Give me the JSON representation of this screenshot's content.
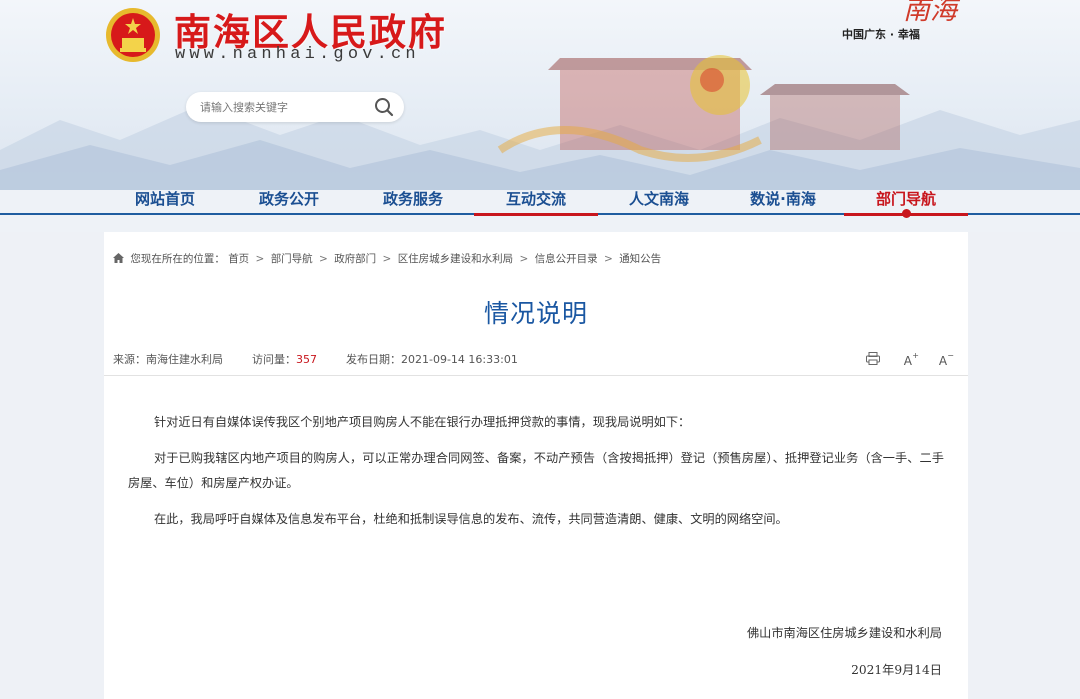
{
  "header": {
    "site_title": "南海区人民政府",
    "site_url": "www.nanhai.gov.cn",
    "region_text": "中国广东 · 幸福",
    "region_art": "南海",
    "search": {
      "placeholder": "请输入搜索关键字"
    }
  },
  "nav": {
    "items": [
      {
        "label": "网站首页"
      },
      {
        "label": "政务公开"
      },
      {
        "label": "政务服务"
      },
      {
        "label": "互动交流"
      },
      {
        "label": "人文南海"
      },
      {
        "label": "数说·南海"
      },
      {
        "label": "部门导航"
      }
    ]
  },
  "breadcrumb": {
    "prefix": "您现在所在的位置：",
    "items": [
      "首页",
      "部门导航",
      "政府部门",
      "区住房城乡建设和水利局",
      "信息公开目录",
      "通知公告"
    ],
    "separator": ">"
  },
  "article": {
    "title": "情况说明",
    "source_label": "来源：",
    "source": "南海住建水利局",
    "views_label": "访问量：",
    "views": "357",
    "date_label": "发布日期：",
    "date": "2021-09-14 16:33:01",
    "paragraphs": [
      "针对近日有自媒体误传我区个别地产项目购房人不能在银行办理抵押贷款的事情，现我局说明如下：",
      "对于已购我辖区内地产项目的购房人，可以正常办理合同网签、备案，不动产预告（含按揭抵押）登记（预售房屋）、抵押登记业务（含一手、二手房屋、车位）和房屋产权办证。",
      "在此，我局呼吁自媒体及信息发布平台，杜绝和抵制误导信息的发布、流传，共同营造清朗、健康、文明的网络空间。"
    ],
    "signature_org": "佛山市南海区住房城乡建设和水利局",
    "signature_date": "2021年9月14日"
  },
  "tools": {
    "print_icon": "print-icon",
    "font_larger": "A",
    "font_smaller": "A",
    "plus": "+",
    "minus": "−"
  },
  "colors": {
    "brand_red": "#d7191a",
    "nav_blue": "#1b4f92",
    "title_blue": "#1a57a2"
  }
}
